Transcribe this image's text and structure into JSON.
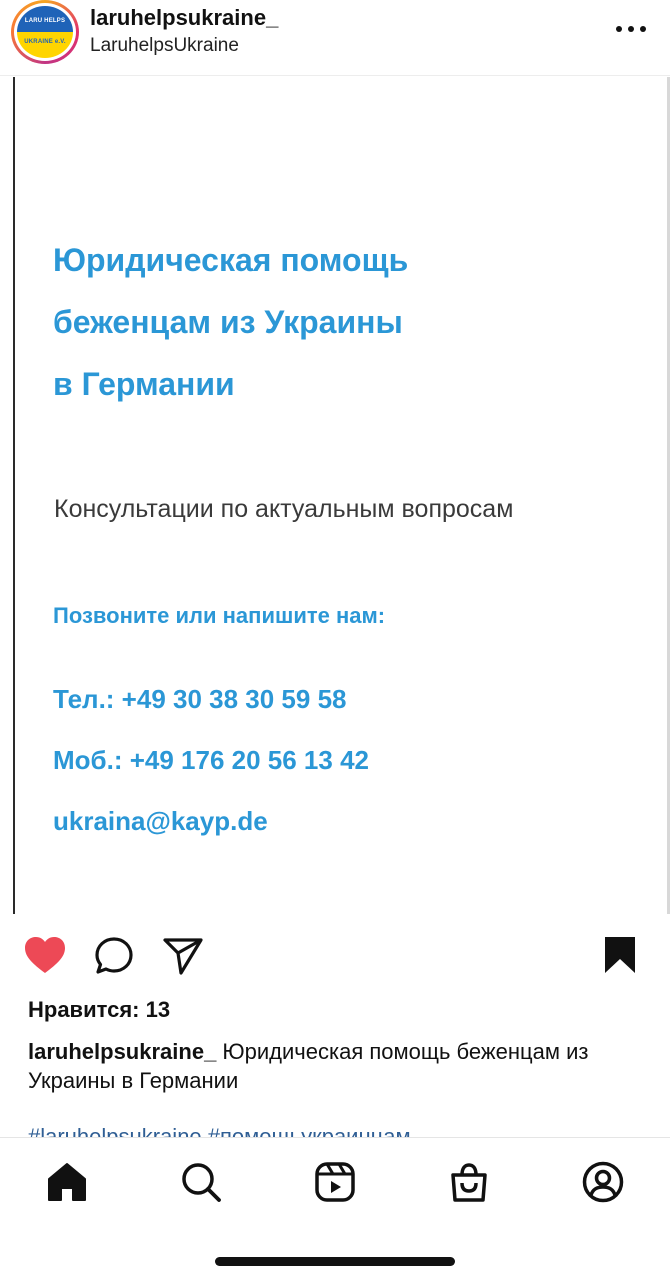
{
  "header": {
    "avatar_text_top": "LARU HELPS",
    "avatar_text_bottom": "UKRAINE e.V.",
    "username": "laruhelpsukraine_",
    "display_name": "LaruhelpsUkraine"
  },
  "post_image": {
    "title_lines": [
      "Юридическая помощь",
      "беженцам из Украины",
      "в Германии"
    ],
    "subtitle": "Консультации по актуальным вопросам",
    "contact_heading": "Позвоните или напишите нам:",
    "phone": "Тел.:  +49 30 38 30 59 58",
    "mobile": "Моб.: +49 176 20 56 13 42",
    "email": "ukraina@kayp.de",
    "accent_color": "#2b97d6"
  },
  "actions": {
    "like_icon": "heart-filled-icon",
    "comment_icon": "comment-icon",
    "share_icon": "paper-plane-icon",
    "save_icon": "bookmark-filled-icon",
    "like_color": "#ed4956"
  },
  "likes": "Нравится: 13",
  "caption": {
    "username": "laruhelpsukraine_",
    "text": " Юридическая помощь беженцам из Украины в Германии"
  },
  "hashtags": "#laruhelpsukraine #помощьукраинцам",
  "bottom_nav": [
    "home-icon",
    "search-icon",
    "reels-icon",
    "shop-icon",
    "profile-icon"
  ]
}
